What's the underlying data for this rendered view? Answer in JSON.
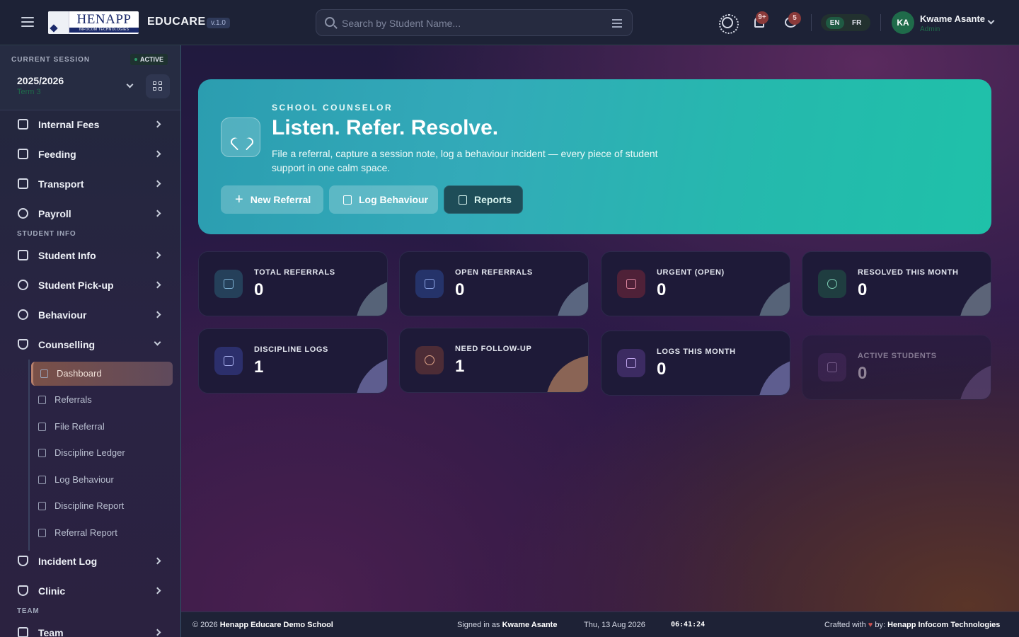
{
  "header": {
    "logo_text": "HENAPP",
    "logo_sub": "INFOCOM TECHNOLOGIES",
    "brand": "EDUCARE",
    "version": "v.1.0",
    "search_placeholder": "Search by Student Name...",
    "notif_badge": "9+",
    "msg_badge": "5",
    "lang": [
      "EN",
      "FR"
    ],
    "avatar_initials": "KA",
    "user_name": "Kwame Asante",
    "user_role": "Admin"
  },
  "session": {
    "label": "CURRENT SESSION",
    "status": "ACTIVE",
    "year": "2025/2026",
    "term": "Term 3"
  },
  "sidebar": {
    "items_top": [
      {
        "label": "Internal Fees",
        "icon": "fees-icon"
      },
      {
        "label": "Feeding",
        "icon": "cart-icon"
      },
      {
        "label": "Transport",
        "icon": "bus-icon"
      },
      {
        "label": "Payroll",
        "icon": "dollar-icon"
      }
    ],
    "section_student": "STUDENT INFO",
    "items_student": [
      {
        "label": "Student Info",
        "icon": "users-icon"
      },
      {
        "label": "Student Pick-up",
        "icon": "user-icon"
      },
      {
        "label": "Behaviour",
        "icon": "check-circle-icon"
      },
      {
        "label": "Counselling",
        "icon": "shield-icon"
      }
    ],
    "sub_items": [
      {
        "label": "Dashboard"
      },
      {
        "label": "Referrals"
      },
      {
        "label": "File Referral"
      },
      {
        "label": "Discipline Ledger"
      },
      {
        "label": "Log Behaviour"
      },
      {
        "label": "Discipline Report"
      },
      {
        "label": "Referral Report"
      }
    ],
    "items_after": [
      {
        "label": "Incident Log",
        "icon": "shield-icon"
      },
      {
        "label": "Clinic",
        "icon": "shield-icon"
      }
    ],
    "section_team": "TEAM",
    "item_team": "Team"
  },
  "hero": {
    "eyebrow": "SCHOOL COUNSELOR",
    "title": "Listen. Refer. Resolve.",
    "description": "File a referral, capture a session note, log a behaviour incident — every piece of student support in one calm space.",
    "buttons": [
      "New Referral",
      "Log Behaviour",
      "Reports"
    ]
  },
  "stats": [
    {
      "title": "TOTAL REFERRALS",
      "value": "0",
      "color": "#2d3f5c"
    },
    {
      "title": "OPEN REFERRALS",
      "value": "0",
      "color": "#2a3566"
    },
    {
      "title": "URGENT (OPEN)",
      "value": "0",
      "color": "#4a2440"
    },
    {
      "title": "RESOLVED THIS MONTH",
      "value": "0",
      "color": "#223c44"
    },
    {
      "title": "DISCIPLINE LOGS",
      "value": "1",
      "color": "#2e2f62"
    },
    {
      "title": "NEED FOLLOW-UP",
      "value": "1",
      "color": "#4a2d3a"
    },
    {
      "title": "LOGS THIS MONTH",
      "value": "0",
      "color": "#3a2d5a"
    },
    {
      "title": "ACTIVE STUDENTS",
      "value": "0",
      "color": "#3a2a55"
    }
  ],
  "footer": {
    "copyright_prefix": "© 2026",
    "school": "Henapp Educare Demo School",
    "signed_prefix": "Signed in as",
    "signed_user": "Kwame Asante",
    "date": "Thu, 13 Aug 2026",
    "time": "06:41:24",
    "crafted_prefix": "Crafted with",
    "crafted_by": "by:",
    "company": "Henapp Infocom Technologies"
  }
}
